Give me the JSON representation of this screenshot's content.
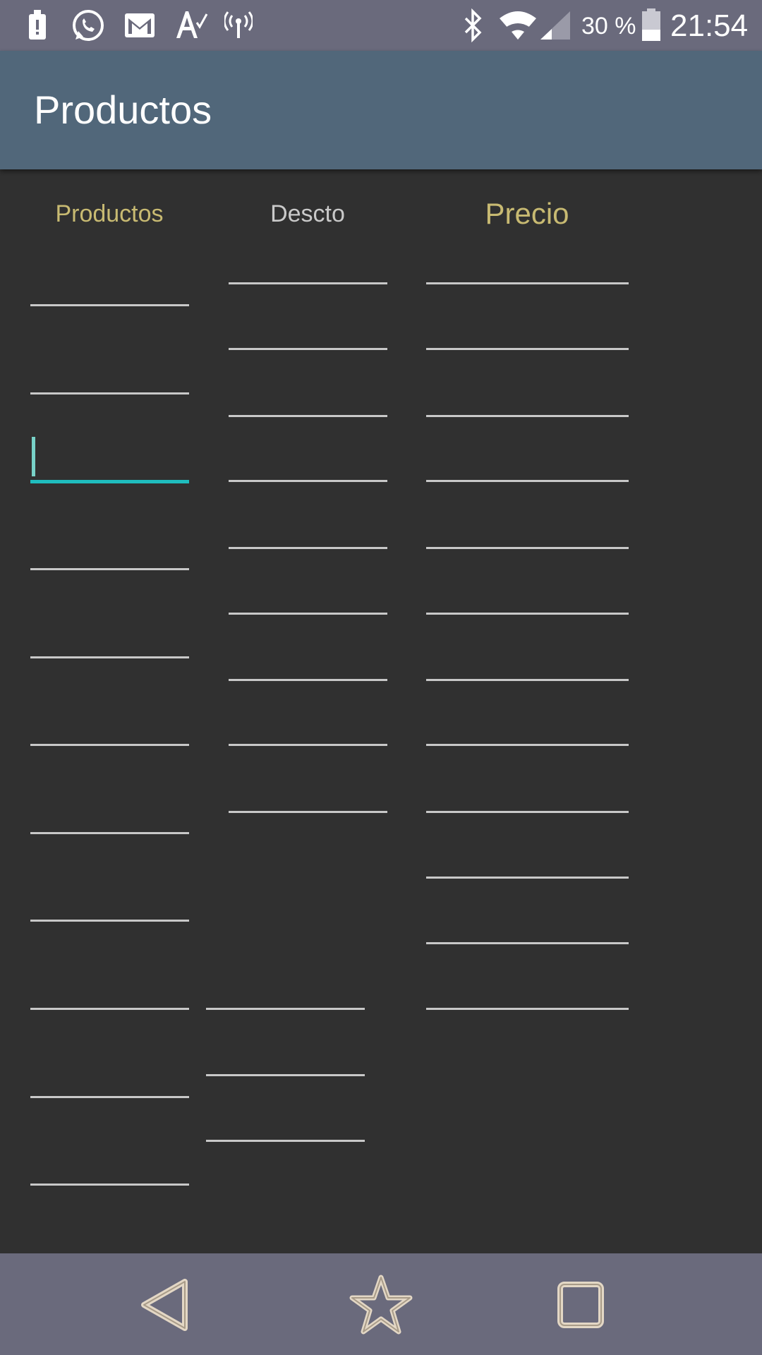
{
  "status_bar": {
    "left_icons": [
      "alert-icon",
      "whatsapp-icon",
      "gmail-icon",
      "spellcheck-icon",
      "hotspot-icon"
    ],
    "right_icons": [
      "bluetooth-icon",
      "wifi-icon",
      "cell-signal-icon",
      "battery-icon"
    ],
    "battery_text": "30 %",
    "time": "21:54"
  },
  "app_bar": {
    "title": "Productos"
  },
  "columns": {
    "productos": "Productos",
    "descto": "Descto",
    "precio": "Precio"
  },
  "colors": {
    "header_yellow": "#c8ba72",
    "header_gray": "#c9c9c9",
    "accent": "#1fbdbe",
    "app_bar": "#51677a",
    "system_bar": "#6a6a7c",
    "background": "#303030"
  },
  "nav_bar": {
    "buttons": [
      "back-triangle-icon",
      "star-icon",
      "recents-square-icon"
    ]
  }
}
